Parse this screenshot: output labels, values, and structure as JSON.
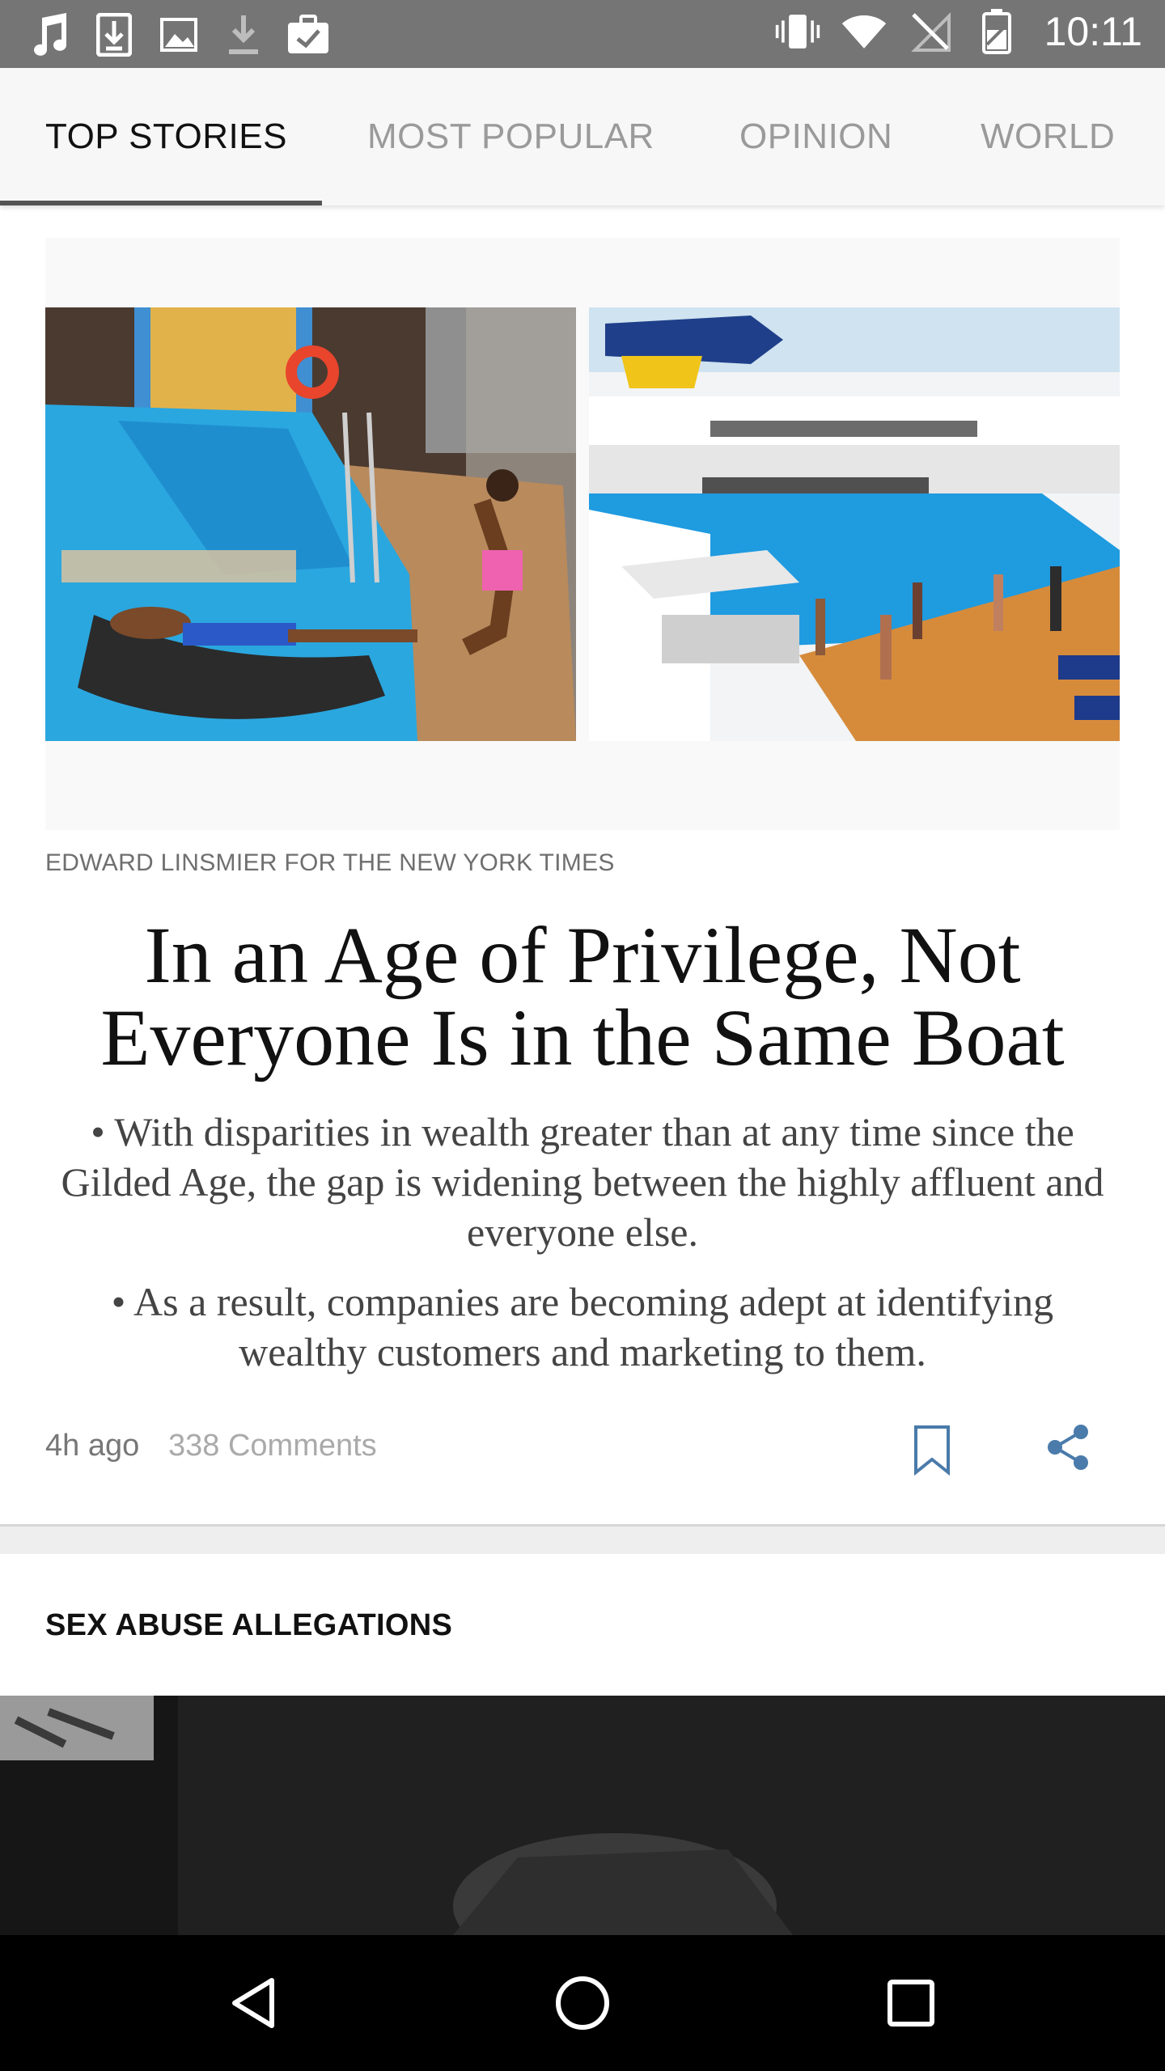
{
  "status_bar": {
    "time": "10:11",
    "left_icons": [
      "music-note-icon",
      "download-box-icon",
      "image-icon",
      "download-icon",
      "clipboard-check-icon"
    ],
    "right_icons": [
      "vibrate-icon",
      "wifi-icon",
      "no-sim-icon",
      "battery-icon"
    ]
  },
  "tabs": [
    {
      "label": "TOP STORIES",
      "active": true
    },
    {
      "label": "MOST POPULAR",
      "active": false
    },
    {
      "label": "OPINION",
      "active": false
    },
    {
      "label": "WORLD",
      "active": false
    }
  ],
  "lead": {
    "photo_credit": "EDWARD LINSMIER FOR THE NEW YORK TIMES",
    "headline": "In an Age of Privilege, Not Everyone Is in the Same Boat",
    "summary": [
      "• With disparities in wealth greater than at any time since the Gilded Age, the gap is widening between the highly affluent and everyone else.",
      "• As a result, companies are becoming adept at identifying wealthy customers and marketing to them."
    ],
    "time_ago": "4h ago",
    "comments": "338 Comments"
  },
  "next_section": {
    "label": "SEX ABUSE ALLEGATIONS"
  },
  "colors": {
    "status_bar": "#757575",
    "tab_bar": "#f7f7f7",
    "tab_indicator": "#555555",
    "action_icon": "#4a7bab",
    "nav_bar": "#000000"
  }
}
